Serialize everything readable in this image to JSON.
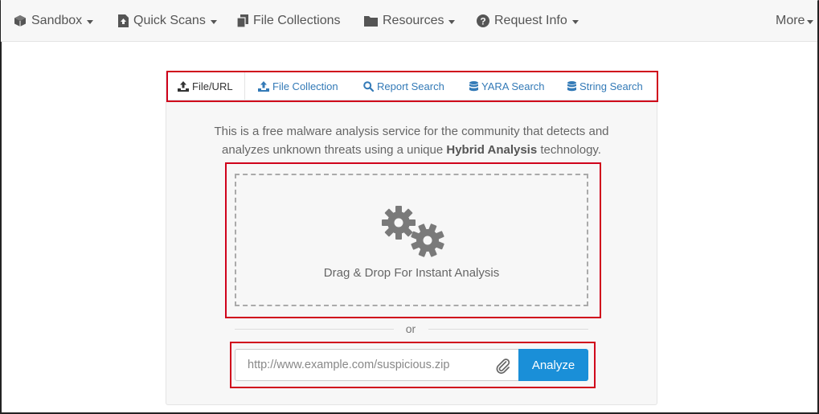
{
  "nav": {
    "items": [
      {
        "label": "Sandbox",
        "icon": "cube-icon",
        "dropdown": true
      },
      {
        "label": "Quick Scans",
        "icon": "file-upload-icon",
        "dropdown": true
      },
      {
        "label": "File Collections",
        "icon": "files-icon",
        "dropdown": false
      },
      {
        "label": "Resources",
        "icon": "folder-icon",
        "dropdown": true
      },
      {
        "label": "Request Info",
        "icon": "question-circle-icon",
        "dropdown": true
      }
    ],
    "more_label": "More"
  },
  "tabs": [
    {
      "label": "File/URL",
      "icon": "upload-icon",
      "active": true
    },
    {
      "label": "File Collection",
      "icon": "upload-icon",
      "active": false
    },
    {
      "label": "Report Search",
      "icon": "search-icon",
      "active": false
    },
    {
      "label": "YARA Search",
      "icon": "database-icon",
      "active": false
    },
    {
      "label": "String Search",
      "icon": "database-icon",
      "active": false
    }
  ],
  "intro": {
    "line1": "This is a free malware analysis service for the community that detects and",
    "line2_prefix": "analyzes unknown threats using a unique ",
    "line2_bold": "Hybrid Analysis",
    "line2_suffix": " technology."
  },
  "dropzone": {
    "label": "Drag & Drop For Instant Analysis",
    "icon": "gears-icon"
  },
  "separator": {
    "label": "or"
  },
  "url_form": {
    "placeholder": "http://www.example.com/suspicious.zip",
    "value": "",
    "attach_icon": "paperclip-icon",
    "submit_label": "Analyze"
  },
  "colors": {
    "link": "#337ab7",
    "button": "#1a8fd8",
    "highlight_box": "#d0021b",
    "nav_bg": "#f7f7f7"
  }
}
